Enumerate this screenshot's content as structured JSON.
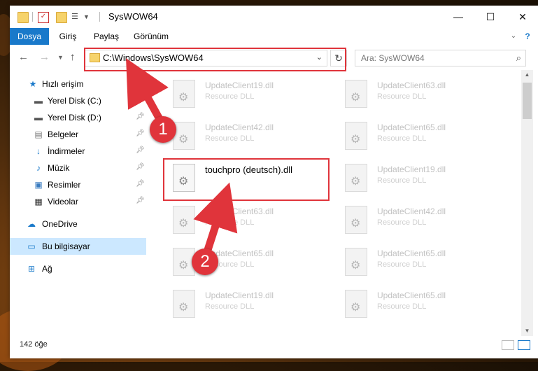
{
  "window": {
    "title": "SysWOW64",
    "controls": [
      "—",
      "☐",
      "✕"
    ]
  },
  "ribbon": {
    "tabs": [
      {
        "label": "Dosya",
        "active": true
      },
      {
        "label": "Giriş",
        "active": false
      },
      {
        "label": "Paylaş",
        "active": false
      },
      {
        "label": "Görünüm",
        "active": false
      }
    ],
    "help": "?"
  },
  "address": {
    "path": "C:\\Windows\\SysWOW64",
    "search_placeholder": "Ara: SysWOW64"
  },
  "sidebar": {
    "items": [
      {
        "label": "Hızlı erişim",
        "icon": "star-icon",
        "pinned": false
      },
      {
        "label": "Yerel Disk (C:)",
        "icon": "drive-icon",
        "pinned": true
      },
      {
        "label": "Yerel Disk (D:)",
        "icon": "drive-icon",
        "pinned": true
      },
      {
        "label": "Belgeler",
        "icon": "document-icon",
        "pinned": true
      },
      {
        "label": "İndirmeler",
        "icon": "download-icon",
        "pinned": true
      },
      {
        "label": "Müzik",
        "icon": "music-icon",
        "pinned": true
      },
      {
        "label": "Resimler",
        "icon": "pictures-icon",
        "pinned": true
      },
      {
        "label": "Videolar",
        "icon": "video-icon",
        "pinned": true
      },
      {
        "label": "OneDrive",
        "icon": "cloud-icon",
        "pinned": false
      },
      {
        "label": "Bu bilgisayar",
        "icon": "computer-icon",
        "pinned": false,
        "selected": true
      },
      {
        "label": "Ağ",
        "icon": "network-icon",
        "pinned": false
      }
    ]
  },
  "files": {
    "left": [
      {
        "name": "UpdateClient19.dll",
        "type": "Resource DLL"
      },
      {
        "name": "UpdateClient42.dll",
        "type": "Resource DLL"
      },
      {
        "name": "touchpro (deutsch).dll",
        "type": "",
        "highlighted": true
      },
      {
        "name": "UpdateClient63.dll",
        "type": "Resource DLL"
      },
      {
        "name": "UpdateClient65.dll",
        "type": "Resource DLL"
      },
      {
        "name": "UpdateClient19.dll",
        "type": "Resource DLL"
      }
    ],
    "right": [
      {
        "name": "UpdateClient63.dll",
        "type": "Resource DLL"
      },
      {
        "name": "UpdateClient65.dll",
        "type": "Resource DLL"
      },
      {
        "name": "UpdateClient19.dll",
        "type": "Resource DLL"
      },
      {
        "name": "UpdateClient42.dll",
        "type": "Resource DLL"
      },
      {
        "name": "UpdateClient65.dll",
        "type": "Resource DLL"
      },
      {
        "name": "UpdateClient65.dll",
        "type": "Resource DLL"
      }
    ]
  },
  "status": {
    "item_count": "142 öğe"
  },
  "annotations": {
    "step1": "1",
    "step2": "2",
    "color": "#e0343b"
  },
  "colors": {
    "accent": "#1979ca",
    "selected": "#cce8ff"
  }
}
